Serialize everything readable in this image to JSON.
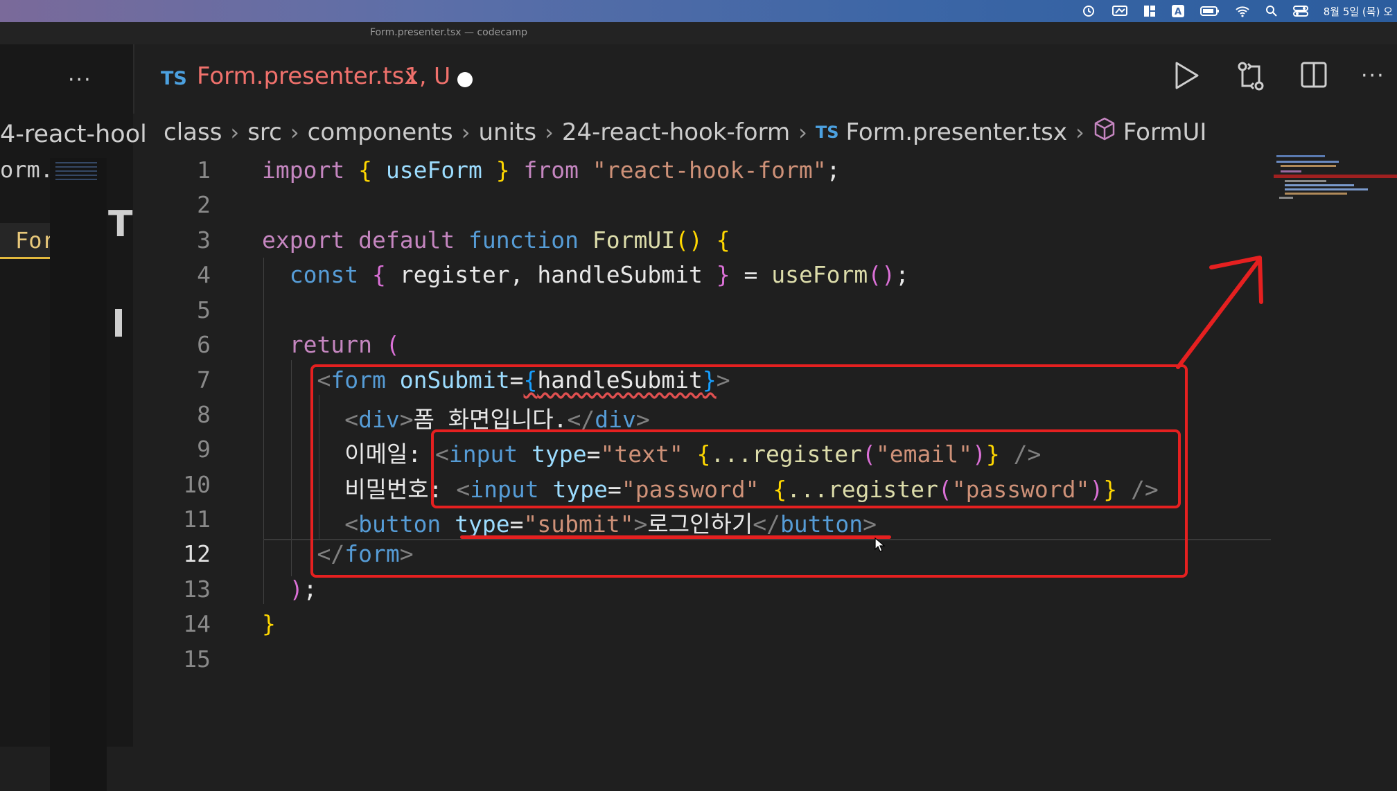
{
  "window": {
    "title": "Form.presenter.tsx — codecamp"
  },
  "menubar": {
    "clock": "8월 5일 (목) 오"
  },
  "sidebar": {
    "more_icon": "ellipsis-icon",
    "crumb_fragment": "4-react-hool",
    "file_fragment_1": "orm.",
    "file_fragment_2": "For",
    "big_letter": "T"
  },
  "tab": {
    "lang_badge": "TS",
    "filename": "Form.presenter.tsx",
    "status": "1, U"
  },
  "editor_actions": [
    "run-icon",
    "compare-changes-icon",
    "split-editor-icon",
    "ellipsis-icon"
  ],
  "breadcrumb": [
    {
      "label": "class"
    },
    {
      "label": "src"
    },
    {
      "label": "components"
    },
    {
      "label": "units"
    },
    {
      "label": "24-react-hook-form"
    },
    {
      "label": "Form.presenter.tsx",
      "badge": "TS"
    },
    {
      "label": "FormUI",
      "icon": "symbol-cube-icon"
    }
  ],
  "code": {
    "line_numbers": [
      "1",
      "2",
      "3",
      "4",
      "5",
      "6",
      "7",
      "8",
      "9",
      "10",
      "11",
      "12",
      "13",
      "14",
      "15"
    ],
    "active_line": "12",
    "l1": {
      "import": "import",
      "ob": "{",
      "name": "useForm",
      "cb": "}",
      "from": "from",
      "module": "\"react-hook-form\"",
      "semi": ";"
    },
    "l3": {
      "export": "export",
      "default": "default",
      "function": "function",
      "name": "FormUI",
      "parens": "()",
      "brace": "{"
    },
    "l4": {
      "const": "const",
      "ob": "{",
      "a": "register,",
      "b": "handleSubmit",
      "cb": "}",
      "eq": "=",
      "call": "useForm",
      "parens": "()",
      "semi": ";"
    },
    "l6": {
      "ret": "return",
      "paren": "("
    },
    "l7": {
      "lt": "<",
      "tag": "form",
      "attr": "onSubmit",
      "eq": "=",
      "ob": "{",
      "val": "handleSubmit",
      "cb": "}",
      "gt": ">"
    },
    "l8": {
      "open": "<",
      "tag": "div",
      "gt": ">",
      "text": "폼 화면입니다.",
      "close_lt": "</",
      "close_tag": "div",
      "close_gt": ">"
    },
    "l9": {
      "label": "이메일:",
      "lt": "<",
      "tag": "input",
      "attr": "type",
      "eq": "=",
      "val": "\"text\"",
      "ob": "{",
      "spread": "...register",
      "po": "(",
      "arg": "\"email\"",
      "pc": ")",
      "cb": "}",
      "end": "/>"
    },
    "l10": {
      "label": "비밀번호:",
      "lt": "<",
      "tag": "input",
      "attr": "type",
      "eq": "=",
      "val": "\"password\"",
      "ob": "{",
      "spread": "...register",
      "po": "(",
      "arg": "\"password\"",
      "pc": ")",
      "cb": "}",
      "end": "/>"
    },
    "l11": {
      "lt": "<",
      "tag": "button",
      "attr": "type",
      "eq": "=",
      "val": "\"submit\"",
      "gt": ">",
      "text": "로그인하기",
      "close_lt": "</",
      "close_tag": "button",
      "close_gt": ">"
    },
    "l12": {
      "lt": "</",
      "tag": "form",
      "gt": ">"
    },
    "l13": {
      "close": ")",
      "semi": ";"
    },
    "l14": {
      "brace": "}"
    }
  },
  "colors": {
    "annotation_red": "#e52020",
    "tab_modified": "#f0716c",
    "ts_blue": "#4ca1e0"
  }
}
